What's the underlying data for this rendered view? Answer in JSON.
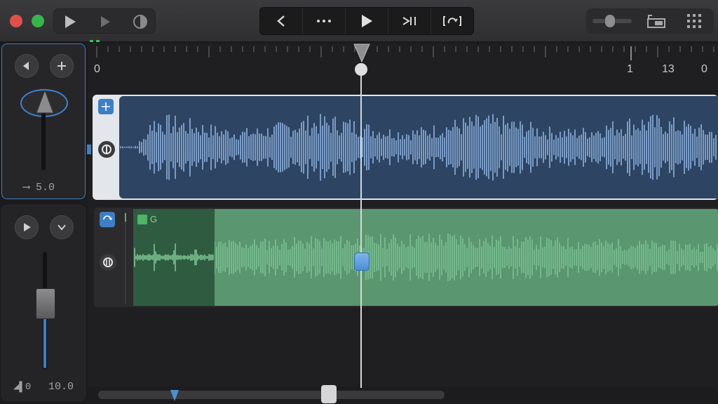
{
  "window": {
    "traffic_lights": [
      {
        "name": "close",
        "color": "#e0504b"
      },
      {
        "name": "zoom",
        "color": "#38b54a"
      }
    ]
  },
  "toolbar": {
    "left": [
      {
        "icon": "play-icon"
      },
      {
        "icon": "play-dim-icon"
      },
      {
        "icon": "eye-icon"
      }
    ],
    "transport": [
      {
        "icon": "back-icon",
        "glyph": "<"
      },
      {
        "icon": "more-icon",
        "glyph": "···"
      },
      {
        "icon": "play-icon"
      },
      {
        "icon": "skip-end-icon"
      },
      {
        "icon": "cycle-icon"
      }
    ],
    "right": [
      {
        "icon": "volume-slider-icon"
      },
      {
        "icon": "track-list-icon"
      },
      {
        "icon": "grid-icon"
      }
    ]
  },
  "tracks": [
    {
      "name": "track-1",
      "selected": true,
      "buttons": [
        "back-circle-icon",
        "add-icon"
      ],
      "value_label": "⟶ 5.0",
      "color": "#3d7fc2",
      "region_color": "#2d4463",
      "wave_color": "#8fb3df"
    },
    {
      "name": "track-2",
      "selected": false,
      "buttons": [
        "play-circle-icon",
        "chevron-down-icon"
      ],
      "value_label_left": "◢▌0",
      "value_label_right": "10.0",
      "color": "#5a9670",
      "region_label": "G",
      "wave_color": "#7cc293"
    }
  ],
  "ruler": {
    "labels": [
      {
        "text": "0"
      },
      {
        "text": "1"
      },
      {
        "text": "13"
      },
      {
        "text": "0"
      }
    ]
  },
  "colors": {
    "accent": "#3d7fc2",
    "background": "#1c1c1e",
    "panel": "#242426"
  }
}
